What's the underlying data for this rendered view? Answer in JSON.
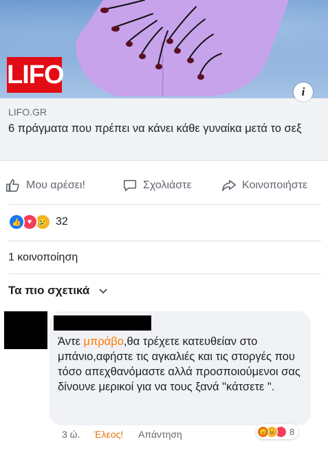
{
  "hero": {
    "logo_text": "LIFO",
    "info_symbol": "i",
    "colors": {
      "background": "#7ea6d8",
      "figure": "#c7a3ec",
      "nails": "#5a1020",
      "logo_bg": "#e30b14"
    }
  },
  "link": {
    "domain": "LIFO.GR",
    "title": "6 πράγματα που πρέπει να κάνει κάθε γυναίκα μετά το σεξ"
  },
  "actions": {
    "like": "Μου αρέσει!",
    "comment": "Σχολιάστε",
    "share": "Κοινοποιήστε"
  },
  "reactions": {
    "icons": [
      "like-icon",
      "love-icon",
      "sad-icon"
    ],
    "count": "32"
  },
  "shares": "1 κοινοποίηση",
  "sort": {
    "label": "Τα πιο σχετικά",
    "chevron": "⌄"
  },
  "comment": {
    "text_before": "Άντε ",
    "highlight": "μπράβο",
    "text_after": ",θα τρέχετε κατευθείαν στο μπάνιο,αφήστε τις αγκαλιές και τις στοργές που τόσο απεχθανόμαστε αλλά προσποιούμενοι σας δίνουνε μερικοί για να τους ξανά \"κάτσετε \".",
    "time": "3 ώ.",
    "reaction_label": "Έλεος!",
    "reply": "Απάντηση",
    "reaction_icons": [
      "angry-icon",
      "haha-icon",
      "love-icon"
    ],
    "reaction_count": "8"
  }
}
